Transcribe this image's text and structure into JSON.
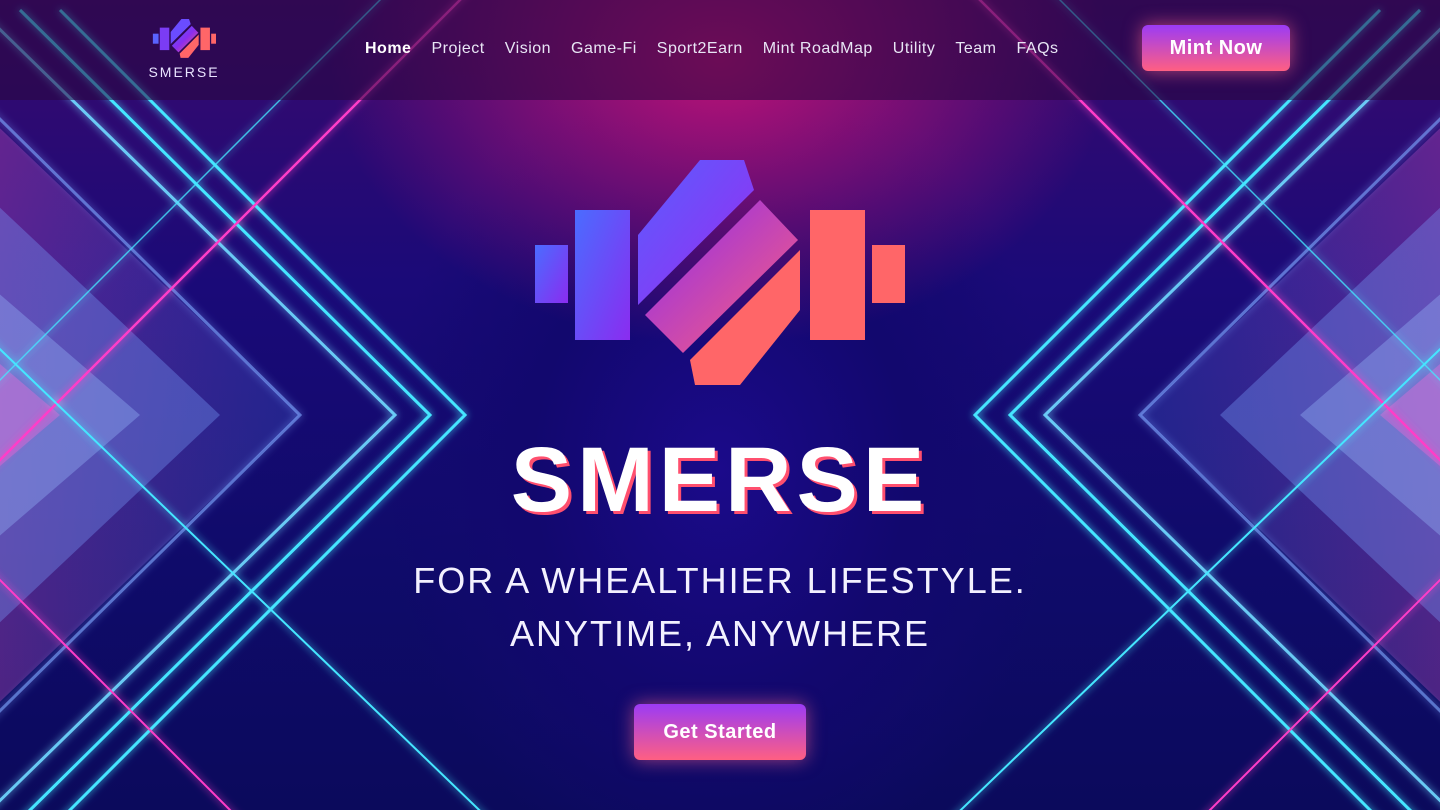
{
  "brand": {
    "name": "SMERSE",
    "logo_icon": "dumbbell-octagon-logo"
  },
  "nav": {
    "items": [
      {
        "label": "Home",
        "active": true
      },
      {
        "label": "Project"
      },
      {
        "label": "Vision"
      },
      {
        "label": "Game-Fi"
      },
      {
        "label": "Sport2Earn"
      },
      {
        "label": "Mint RoadMap"
      },
      {
        "label": "Utility"
      },
      {
        "label": "Team"
      },
      {
        "label": "FAQs"
      }
    ],
    "cta_label": "Mint Now"
  },
  "hero": {
    "title": "SMERSE",
    "tagline_line1": "FOR A WHEALTHIER LIFESTYLE.",
    "tagline_line2": "ANYTIME, ANYWHERE",
    "cta_label": "Get Started"
  },
  "colors": {
    "accent_start": "#9b3bf5",
    "accent_end": "#ff5f82",
    "logo_blue": "#4a6cff",
    "logo_purple": "#8a2cf0",
    "logo_coral": "#ff6668",
    "background": "#0f0b6a",
    "neon_cyan": "#45e6ff",
    "neon_magenta": "#ff3cc8"
  }
}
